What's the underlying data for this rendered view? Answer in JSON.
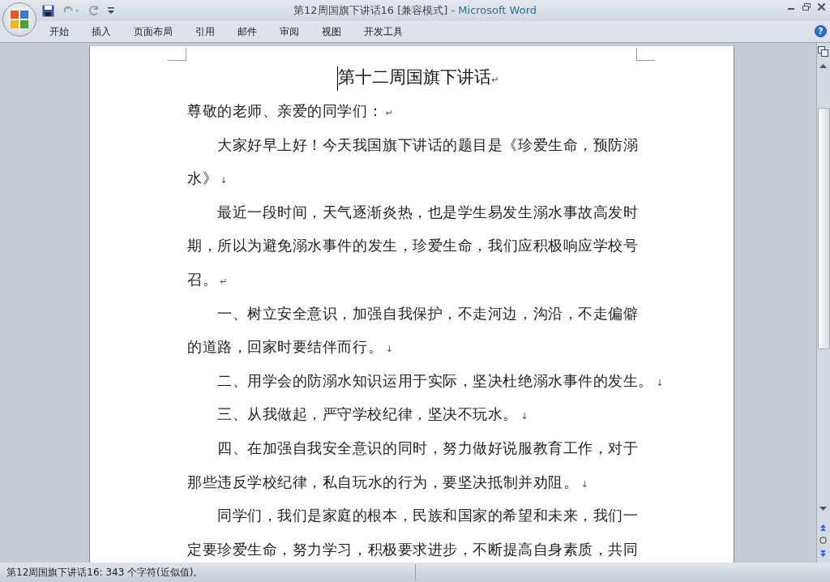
{
  "window": {
    "title": "第12周国旗下讲话16 [兼容模式]",
    "app_name": "- Microsoft Word"
  },
  "ribbon_tabs": [
    {
      "label": "开始",
      "selected": false
    },
    {
      "label": "插入",
      "selected": false
    },
    {
      "label": "页面布局",
      "selected": false
    },
    {
      "label": "引用",
      "selected": false
    },
    {
      "label": "邮件",
      "selected": false
    },
    {
      "label": "审阅",
      "selected": false
    },
    {
      "label": "视图",
      "selected": false
    },
    {
      "label": "开发工具",
      "selected": false
    }
  ],
  "document": {
    "title": "第十二周国旗下讲话",
    "title_mark": "↵",
    "paragraphs": [
      {
        "indent": false,
        "lines": [
          "尊敬的老师、亲爱的同学们："
        ],
        "mark": "↵"
      },
      {
        "indent": true,
        "lines": [
          "大家好早上好！今天我国旗下讲话的题目是《珍爱生命，预防溺",
          "水》"
        ],
        "mark": "↓"
      },
      {
        "indent": true,
        "lines": [
          "最近一段时间，天气逐渐炎热，也是学生易发生溺水事故高发时",
          "期，所以为避免溺水事件的发生，珍爱生命，我们应积极响应学校号",
          "召。"
        ],
        "mark": "↵"
      },
      {
        "indent": true,
        "lines": [
          "一、树立安全意识，加强自我保护，不走河边，沟沿，不走偏僻",
          "的道路，回家时要结伴而行。"
        ],
        "mark": "↓"
      },
      {
        "indent": true,
        "lines": [
          "二、用学会的防溺水知识运用于实际，坚决杜绝溺水事件的发生。"
        ],
        "mark": "↓"
      },
      {
        "indent": true,
        "lines": [
          "三、从我做起，严守学校纪律，坚决不玩水。"
        ],
        "mark": "↓"
      },
      {
        "indent": true,
        "lines": [
          "四、在加强自我安全意识的同时，努力做好说服教育工作，对于",
          "那些违反学校纪律，私自玩水的行为，要坚决抵制并劝阻。"
        ],
        "mark": "↓"
      },
      {
        "indent": true,
        "lines": [
          "同学们，我们是家庭的根本，民族和国家的希望和未来，我们一",
          "定要珍爱生命，努力学习，积极要求进步，不断提高自身素质，共同"
        ]
      }
    ]
  },
  "help_button": "?",
  "status_bar": {
    "text": "第12周国旗下讲话16: 343 个字符(近似值)。"
  }
}
